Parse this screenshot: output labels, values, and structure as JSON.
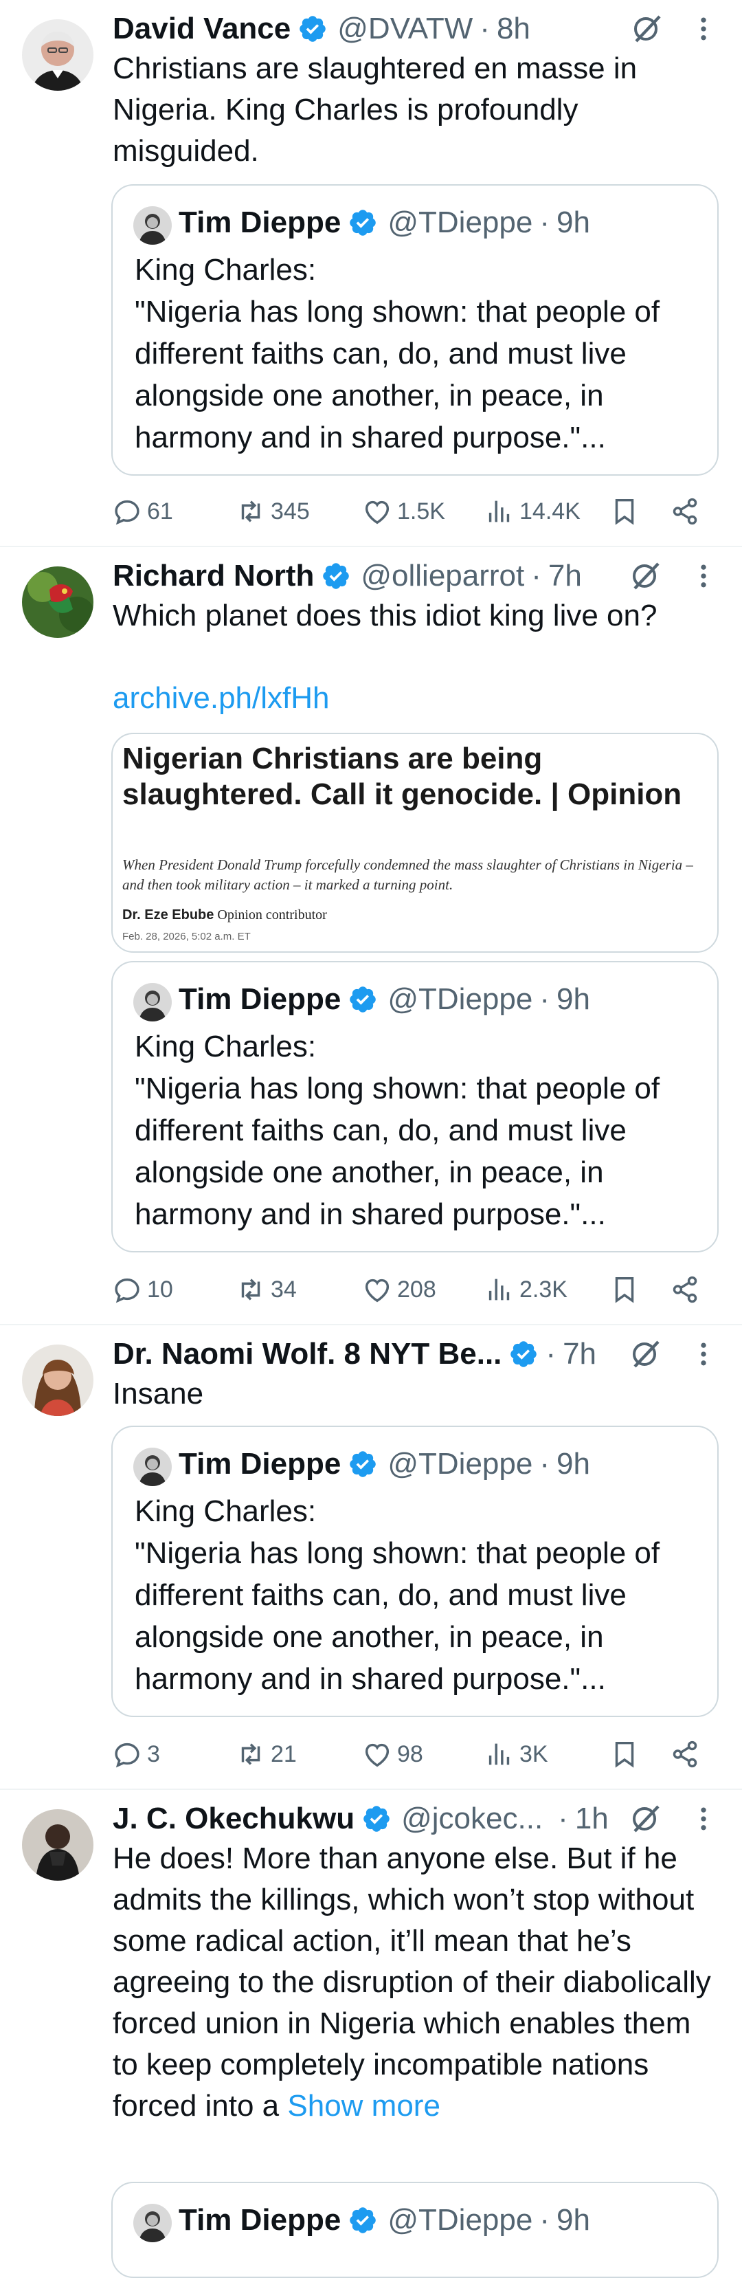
{
  "tweets": [
    {
      "author": "David Vance",
      "handle": "@DVATW",
      "dot": "·",
      "time": "8h",
      "text": "Christians are slaughtered en masse in Nigeria. King Charles is profoundly misguided.",
      "quote": {
        "author": "Tim Dieppe",
        "handle": "@TDieppe",
        "dot": "·",
        "time": "9h",
        "text": "King Charles:\n\"Nigeria has long shown: that people of different faiths can, do, and must live alongside one another, in peace, in harmony and in shared purpose.\"..."
      },
      "stats": {
        "replies": "61",
        "reposts": "345",
        "likes": "1.5K",
        "views": "14.4K"
      }
    },
    {
      "author": "Richard North",
      "handle": "@ollieparrot",
      "dot": "·",
      "time": "7h",
      "text": "Which planet does this idiot king live on?",
      "link": "archive.ph/lxfHh",
      "card": {
        "headline": "Nigerian Christians are being slaughtered. Call it genocide. | Opinion",
        "dek": "When President Donald Trump forcefully condemned the mass slaughter of Christians in Nigeria – and then took military action – it marked a turning point.",
        "author": "Dr. Eze Ebube",
        "author_role": "Opinion contributor",
        "date": "Feb. 28, 2026, 5:02 a.m. ET"
      },
      "quote": {
        "author": "Tim Dieppe",
        "handle": "@TDieppe",
        "dot": "·",
        "time": "9h",
        "text": "King Charles:\n\"Nigeria has long shown: that people of different faiths can, do, and must live alongside one another, in peace, in harmony and in shared purpose.\"..."
      },
      "stats": {
        "replies": "10",
        "reposts": "34",
        "likes": "208",
        "views": "2.3K"
      }
    },
    {
      "author": "Dr. Naomi Wolf. 8 NYT Be...",
      "handle": "",
      "dot": "·",
      "time": "7h",
      "text": "Insane",
      "quote": {
        "author": "Tim Dieppe",
        "handle": "@TDieppe",
        "dot": "·",
        "time": "9h",
        "text": "King Charles:\n\"Nigeria has long shown: that people of different faiths can, do, and must live alongside one another, in peace, in harmony and in shared purpose.\"..."
      },
      "stats": {
        "replies": "3",
        "reposts": "21",
        "likes": "98",
        "views": "3K"
      }
    },
    {
      "author": "J. C. Okechukwu",
      "handle": "@jcokec...",
      "dot": "·",
      "time": "1h",
      "text": "He does! More than anyone else. But if he admits the killings, which won’t stop without some radical action, it’ll mean that he’s agreeing to the disruption of their diabolically forced union in Nigeria which enables them to keep completely incompatible nations forced into a ",
      "show_more": "Show more",
      "quote": {
        "author": "Tim Dieppe",
        "handle": "@TDieppe",
        "dot": "·",
        "time": "9h",
        "text": ""
      }
    }
  ],
  "colors": {
    "text": "#0f1419",
    "secondary": "#536471",
    "link": "#1d9bf0",
    "verified": "#1d9bf0",
    "divider": "#eff3f4",
    "border": "#cfd9de"
  },
  "icons": {
    "reply": "reply-icon",
    "repost": "repost-icon",
    "like": "like-icon",
    "views": "views-icon",
    "bookmark": "bookmark-icon",
    "share": "share-icon",
    "grok": "grok-icon",
    "more": "more-icon",
    "verified": "verified-badge-icon"
  }
}
